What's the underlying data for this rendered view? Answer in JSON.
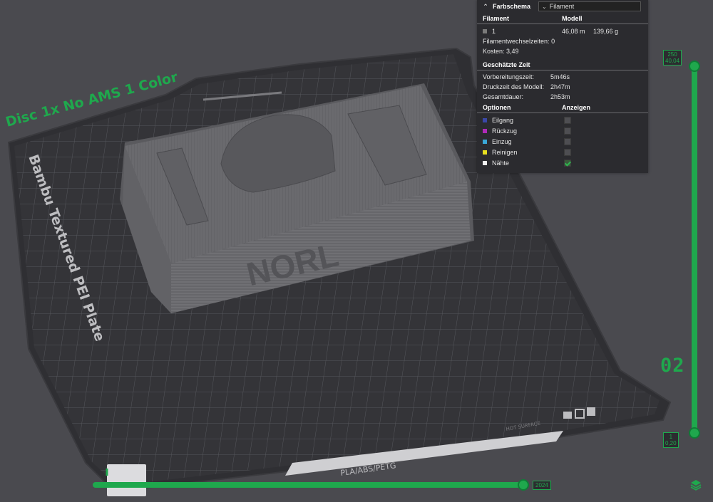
{
  "plate": {
    "project_name": "Disc 1x No AMS 1 Color",
    "plate_name": "Bambu Textured PEI Plate",
    "hot_surface": "HOT SURFACE",
    "materials": "PLA/ABS/PETG",
    "model_text": "NORL"
  },
  "legend": {
    "title": "Farbschema",
    "scheme_selected": "Filament",
    "filament_header": "Filament",
    "model_header": "Modell",
    "filament_row": {
      "index": "1",
      "length": "46,08 m",
      "weight": "139,66 g",
      "color": "#7a7a7a"
    },
    "changes_label": "Filamentwechselzeiten:",
    "changes_value": "0",
    "cost_label": "Kosten:",
    "cost_value": "3,49",
    "time_header": "Geschätzte Zeit",
    "prep_label": "Vorbereitungszeit:",
    "prep_value": "5m46s",
    "print_label": "Druckzeit des Modell:",
    "print_value": "2h47m",
    "total_label": "Gesamtdauer:",
    "total_value": "2h53m",
    "options_header": "Optionen",
    "show_header": "Anzeigen",
    "options": [
      {
        "label": "Eilgang",
        "color": "#3b48a8",
        "checked": false
      },
      {
        "label": "Rückzug",
        "color": "#b02ab8",
        "checked": false
      },
      {
        "label": "Einzug",
        "color": "#3aa8d8",
        "checked": false
      },
      {
        "label": "Reinigen",
        "color": "#e8e020",
        "checked": false
      },
      {
        "label": "Nähte",
        "color": "#f0f0f0",
        "checked": true
      }
    ]
  },
  "layer_slider": {
    "top_layer": "250",
    "top_height": "40,04",
    "bottom_layer": "1",
    "bottom_height": "0,20",
    "large_number": "02"
  },
  "move_slider": {
    "value": "2024"
  },
  "colors": {
    "accent": "#1fa84d",
    "panel": "#2b2b2f"
  }
}
